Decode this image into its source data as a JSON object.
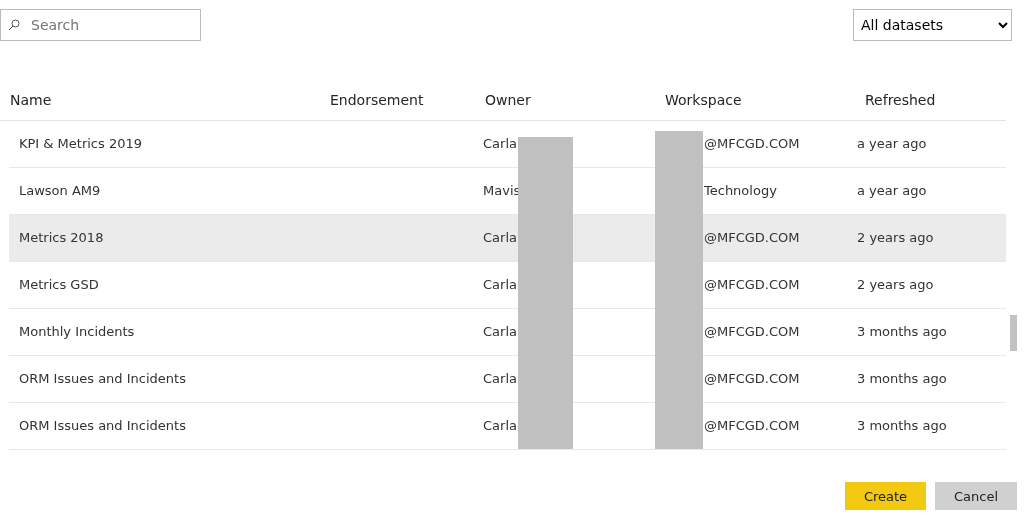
{
  "search": {
    "placeholder": "Search"
  },
  "filter": {
    "value": "All datasets"
  },
  "table": {
    "columns": [
      "Name",
      "Endorsement",
      "Owner",
      "Workspace",
      "Refreshed"
    ],
    "rows": [
      {
        "name": "KPI & Metrics 2019",
        "owner": "Carla",
        "workspace": "@MFCGD.COM",
        "refreshed": "a year ago",
        "selected": false
      },
      {
        "name": "Lawson AM9",
        "owner": "Mavis",
        "workspace": "Technology",
        "refreshed": "a year ago",
        "selected": false
      },
      {
        "name": "Metrics 2018",
        "owner": "Carla",
        "workspace": "@MFCGD.COM",
        "refreshed": "2 years ago",
        "selected": true
      },
      {
        "name": "Metrics GSD",
        "owner": "Carla",
        "workspace": "@MFCGD.COM",
        "refreshed": "2 years ago",
        "selected": false
      },
      {
        "name": "Monthly Incidents",
        "owner": "Carla",
        "workspace": "@MFCGD.COM",
        "refreshed": "3 months ago",
        "selected": false
      },
      {
        "name": "ORM Issues and Incidents",
        "owner": "Carla",
        "workspace": "@MFCGD.COM",
        "refreshed": "3 months ago",
        "selected": false
      },
      {
        "name": "ORM Issues and Incidents",
        "owner": "Carla",
        "workspace": "@MFCGD.COM",
        "refreshed": "3 months ago",
        "selected": false
      }
    ]
  },
  "buttons": [
    {
      "label": "Create",
      "kind": "primary"
    },
    {
      "label": "Cancel",
      "kind": "secondary"
    }
  ]
}
